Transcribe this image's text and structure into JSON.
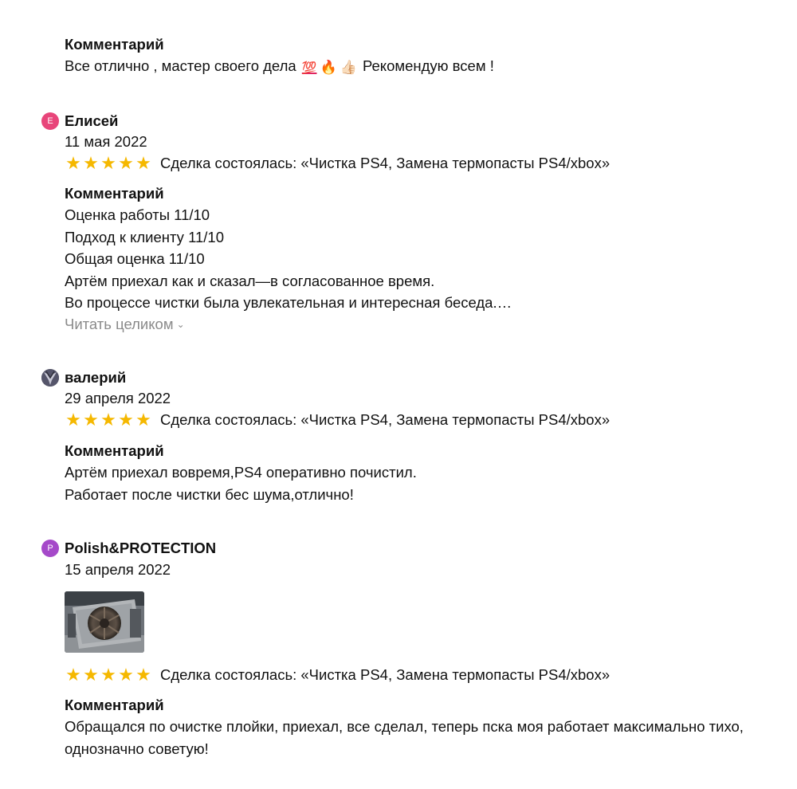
{
  "top_review": {
    "comment_heading": "Комментарий",
    "comment_text_before": "Все отлично , мастер своего дела",
    "emoji": [
      "💯",
      "🔥",
      "👍🏻"
    ],
    "comment_text_after": "Рекомендую всем !"
  },
  "reviews": [
    {
      "avatar_letter": "Е",
      "avatar_color": "#e8457a",
      "author": "Елисей",
      "date": "11 мая 2022",
      "rating": 5,
      "stars": [
        "★",
        "★",
        "★",
        "★",
        "★"
      ],
      "deal": "Сделка состоялась: «Чистка PS4, Замена термопасты PS4/xbox»",
      "comment_heading": "Комментарий",
      "comment_lines": [
        "Оценка работы 11/10",
        "Подход к клиенту 11/10",
        "Общая оценка 11/10",
        "Артём приехал как и сказал—в согласованное время.",
        "Во процессе чистки была увлекательная и интересная беседа.…"
      ],
      "read_more": "Читать целиком"
    },
    {
      "avatar_letter": "",
      "author": "валерий",
      "date": "29 апреля 2022",
      "rating": 5,
      "stars": [
        "★",
        "★",
        "★",
        "★",
        "★"
      ],
      "deal": "Сделка состоялась: «Чистка PS4, Замена термопасты PS4/xbox»",
      "comment_heading": "Комментарий",
      "comment_lines": [
        "Артём приехал вовремя,PS4 оперативно почистил.",
        "Работает после чистки бес шума,отлично!"
      ]
    },
    {
      "avatar_letter": "P",
      "avatar_color": "#a549c9",
      "author": "Polish&PROTECTION",
      "date": "15 апреля 2022",
      "rating": 5,
      "stars": [
        "★",
        "★",
        "★",
        "★",
        "★"
      ],
      "deal": "Сделка состоялась: «Чистка PS4, Замена термопасты PS4/xbox»",
      "comment_heading": "Комментарий",
      "comment_text": "Обращался по очистке плойки, приехал, все сделал, теперь пска моя работает максимально тихо, однозначно советую!"
    }
  ],
  "icons": {
    "star": "star-icon",
    "chevron": "chevron-down-icon"
  },
  "colors": {
    "star": "#f5b800",
    "muted": "#8a8a8a"
  }
}
